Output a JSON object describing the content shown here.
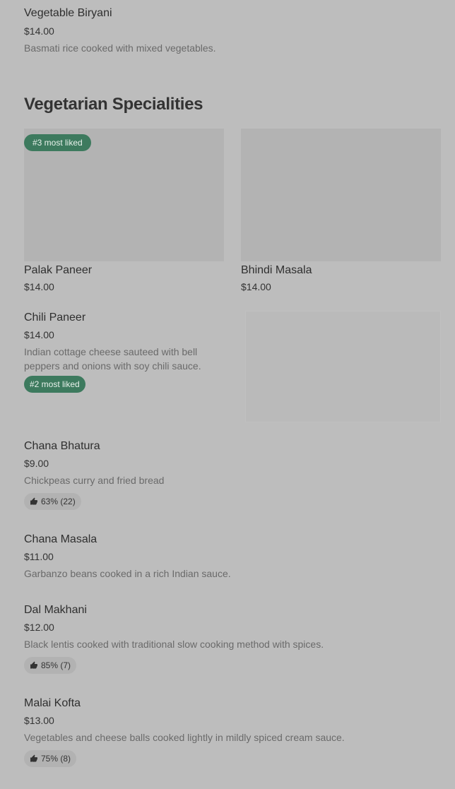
{
  "items": {
    "veg_biryani": {
      "name": "Vegetable Biryani",
      "price": "$14.00",
      "desc": "Basmati rice cooked with mixed vegetables."
    },
    "palak_paneer": {
      "name": "Palak Paneer",
      "price": "$14.00",
      "badge": "#3 most liked"
    },
    "bhindi_masala": {
      "name": "Bhindi Masala",
      "price": "$14.00"
    },
    "chili_paneer": {
      "name": "Chili Paneer",
      "price": "$14.00",
      "desc": "Indian cottage cheese sauteed with bell peppers and onions with soy chili sauce.",
      "badge": "#2 most liked"
    },
    "chana_bhatura": {
      "name": "Chana Bhatura",
      "price": "$9.00",
      "desc": "Chickpeas curry and fried bread",
      "rating": "63% (22)"
    },
    "chana_masala": {
      "name": "Chana Masala",
      "price": "$11.00",
      "desc": "Garbanzo beans cooked in a rich Indian sauce."
    },
    "dal_makhani": {
      "name": "Dal Makhani",
      "price": "$12.00",
      "desc": "Black lentis cooked with traditional slow cooking method with spices.",
      "rating": "85% (7)"
    },
    "malai_kofta": {
      "name": "Malai Kofta",
      "price": "$13.00",
      "desc": "Vegetables and cheese balls cooked lightly in mildly spiced cream sauce.",
      "rating": "75% (8)"
    }
  },
  "sections": {
    "vegetarian_specialities": "Vegetarian Specialities"
  },
  "icons": {
    "rating": "thumbs-up-icon"
  },
  "colors": {
    "badge_green": "#3d7a5e",
    "background": "#bdbdbd",
    "card_image": "#b3b3b3"
  }
}
